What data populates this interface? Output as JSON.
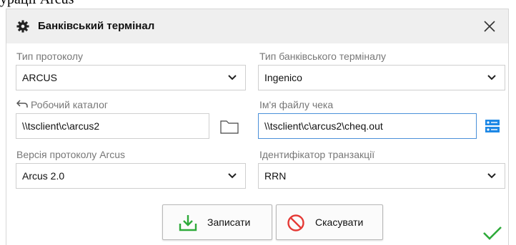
{
  "behind_text": "урації Arcus",
  "dialog": {
    "title": "Банківський термінал",
    "protocol_type": {
      "label": "Тип протоколу",
      "value": "ARCUS"
    },
    "terminal_type": {
      "label": "Тип банківського терміналу",
      "value": "Ingenico"
    },
    "work_dir": {
      "label": "Робочий каталог",
      "value": "\\\\tsclient\\c\\arcus2"
    },
    "receipt_file": {
      "label": "Ім'я файлу чека",
      "value": "\\\\tsclient\\c\\arcus2\\cheq.out"
    },
    "protocol_version": {
      "label": "Версія протоколу Arcus",
      "value": "Arcus 2.0"
    },
    "transaction_id": {
      "label": "Ідентифікатор транзакції",
      "value": "RRN"
    },
    "save_label": "Записати",
    "cancel_label": "Скасувати"
  },
  "colors": {
    "focus_border": "#4a90d9",
    "save_icon": "#2eaa3a",
    "cancel_icon": "#e53935",
    "ok_check": "#2eaa3a",
    "settings_icon": "#1e88e5"
  },
  "icons": [
    "gear-icon",
    "close-icon",
    "back-arrow-icon",
    "folder-icon",
    "settings-list-icon",
    "chevron-down-icon",
    "download-icon",
    "cancel-icon",
    "check-icon"
  ]
}
